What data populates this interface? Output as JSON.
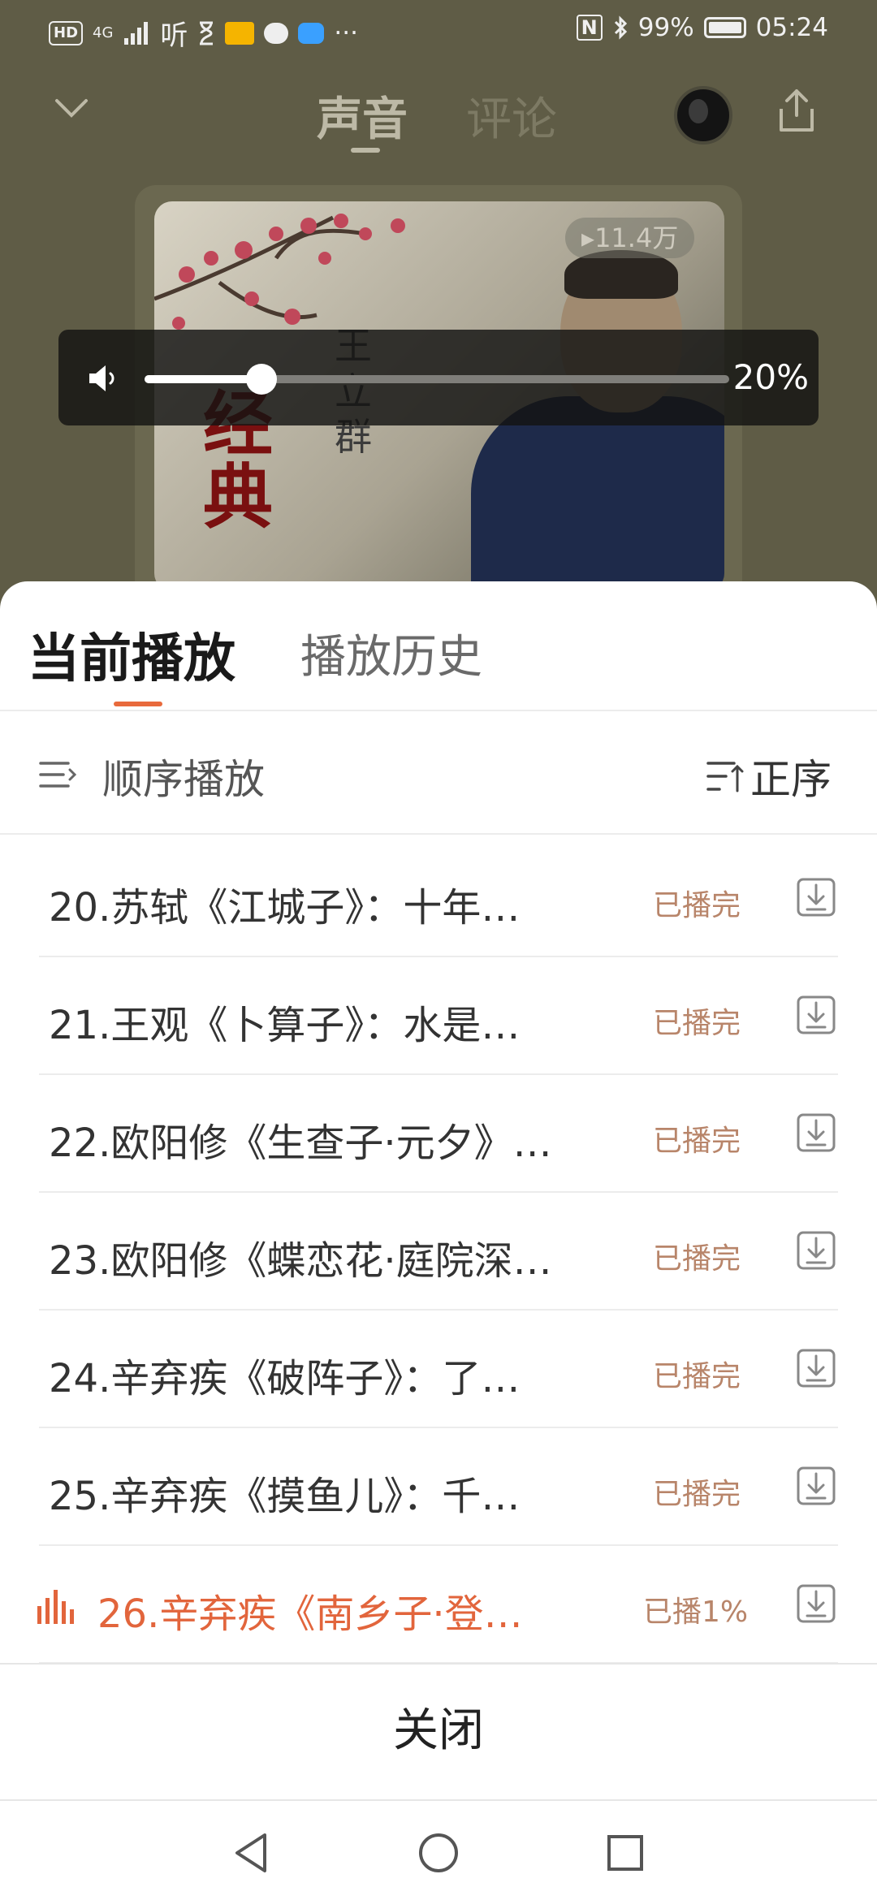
{
  "status_bar": {
    "network": "4G",
    "carrier_glyph": "听",
    "more": "···",
    "nfc": "N",
    "battery": "99%",
    "time": "05:24",
    "icons": [
      "hd-icon",
      "signal-icon",
      "hourglass-icon",
      "mail-icon",
      "chat-icon",
      "cloud-icon",
      "nfc-icon",
      "bluetooth-icon",
      "battery-icon"
    ]
  },
  "player": {
    "tabs": [
      "声音",
      "评论"
    ],
    "active_tab": "声音",
    "play_count": "▸11.4万",
    "cover": {
      "calligraphy": "经典",
      "name_vertical": "王立群"
    }
  },
  "volume": {
    "percent_text": "20%",
    "level": 0.2
  },
  "sheet": {
    "tabs": [
      "当前播放",
      "播放历史"
    ],
    "active_tab": "当前播放",
    "mode_label": "顺序播放",
    "sort_label": "正序",
    "tracks": [
      {
        "title": "20.苏轼《江城子》：十年…",
        "status": "已播完",
        "active": false
      },
      {
        "title": "21.王观《卜算子》：水是…",
        "status": "已播完",
        "active": false
      },
      {
        "title": "22.欧阳修《生查子·元夕》…",
        "status": "已播完",
        "active": false
      },
      {
        "title": "23.欧阳修《蝶恋花·庭院深…",
        "status": "已播完",
        "active": false
      },
      {
        "title": "24.辛弃疾《破阵子》：了…",
        "status": "已播完",
        "active": false
      },
      {
        "title": "25.辛弃疾《摸鱼儿》：千…",
        "status": "已播完",
        "active": false
      },
      {
        "title": "26.辛弃疾《南乡子·登…",
        "status": "已播1%",
        "active": true
      }
    ],
    "close_label": "关闭"
  },
  "colors": {
    "accent": "#e2653c",
    "status_text": "#b8856a",
    "overlay_bg": "#5f5c46"
  }
}
